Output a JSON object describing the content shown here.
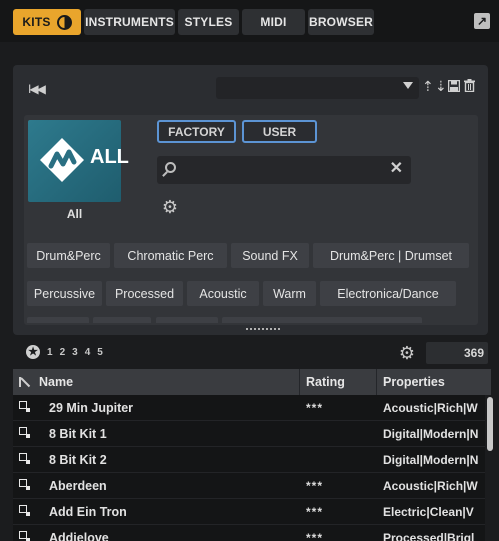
{
  "tabs": [
    {
      "label": "KITS",
      "active": true
    },
    {
      "label": "INSTRUMENTS",
      "active": false
    },
    {
      "label": "STYLES",
      "active": false
    },
    {
      "label": "MIDI",
      "active": false
    },
    {
      "label": "BROWSER",
      "active": false
    }
  ],
  "preset": {
    "prev_label": "I◀◀",
    "selected": "",
    "icons": [
      "dropdown-arrow-icon",
      "up-arrow-icon",
      "down-arrow-icon",
      "save-icon",
      "delete-icon"
    ]
  },
  "filter": {
    "logo_text": "ALL",
    "logo_caption": "All",
    "sources": [
      "FACTORY",
      "USER"
    ],
    "search_value": "",
    "tags_row1": [
      "Drum&Perc",
      "Chromatic Perc",
      "Sound FX",
      "Drum&Perc | Drumset"
    ],
    "tags_row2": [
      "Percussive",
      "Processed",
      "Acoustic",
      "Warm",
      "Electronica/Dance"
    ]
  },
  "rating_filter": {
    "levels": [
      "1",
      "2",
      "3",
      "4",
      "5"
    ]
  },
  "result_count": "369",
  "table": {
    "columns": [
      "Name",
      "Rating",
      "Properties"
    ],
    "rows": [
      {
        "name": "29 Min Jupiter",
        "rating": "***",
        "properties": "Acoustic|Rich|W"
      },
      {
        "name": "8 Bit Kit 1",
        "rating": "",
        "properties": "Digital|Modern|N"
      },
      {
        "name": "8 Bit Kit 2",
        "rating": "",
        "properties": "Digital|Modern|N"
      },
      {
        "name": "Aberdeen",
        "rating": "***",
        "properties": "Acoustic|Rich|W"
      },
      {
        "name": "Add Ein Tron",
        "rating": "***",
        "properties": "Electric|Clean|V"
      },
      {
        "name": "Addielove",
        "rating": "***",
        "properties": "Processed|Brigl"
      }
    ]
  },
  "colors": {
    "accent": "#e9a52c",
    "source_border": "#5c94d4",
    "logo": "#2e7a8d"
  }
}
